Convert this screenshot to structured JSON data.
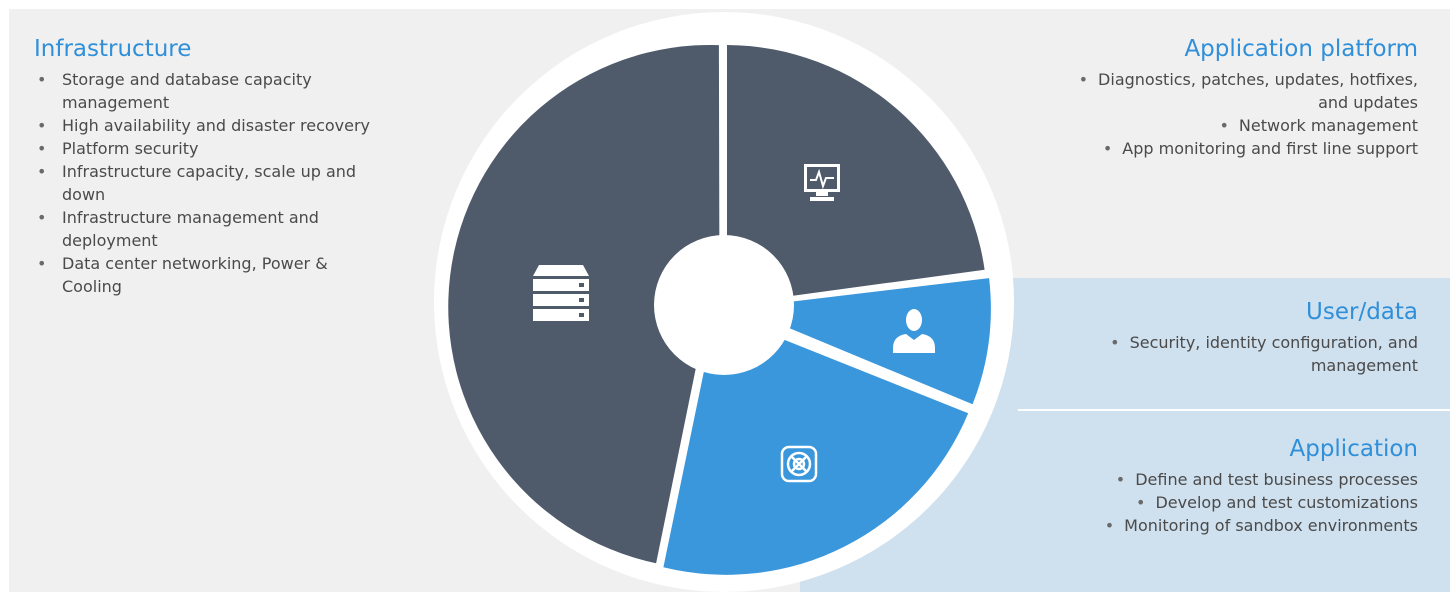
{
  "colors": {
    "segment_dark": "#4f5a6b",
    "segment_blue": "#3a97dc",
    "heading_blue": "#2f8fd9",
    "panel_gray": "#f0f0f0",
    "panel_blue": "#cfe0ee"
  },
  "segments": [
    {
      "name": "application-platform",
      "icon": "monitor-heartbeat-icon",
      "color": "#4f5a6b"
    },
    {
      "name": "user-data",
      "icon": "user-icon",
      "color": "#3a97dc"
    },
    {
      "name": "application",
      "icon": "settings-grid-icon",
      "color": "#3a97dc"
    },
    {
      "name": "infrastructure",
      "icon": "server-stack-icon",
      "color": "#4f5a6b"
    }
  ],
  "infrastructure": {
    "title": "Infrastructure",
    "items": [
      "Storage and database capacity management",
      "High availability and disaster recovery",
      "Platform security",
      "Infrastructure capacity, scale up and down",
      "Infrastructure management and deployment",
      "Data center networking, Power & Cooling"
    ]
  },
  "application_platform": {
    "title": "Application platform",
    "items": [
      "Diagnostics, patches, updates, hotfixes, and updates",
      "Network management",
      "App monitoring and first line support"
    ]
  },
  "user_data": {
    "title": "User/data",
    "items": [
      "Security, identity configuration, and management"
    ]
  },
  "application": {
    "title": "Application",
    "items": [
      "Define and test business processes",
      "Develop and test customizations",
      "Monitoring of sandbox environments"
    ]
  }
}
